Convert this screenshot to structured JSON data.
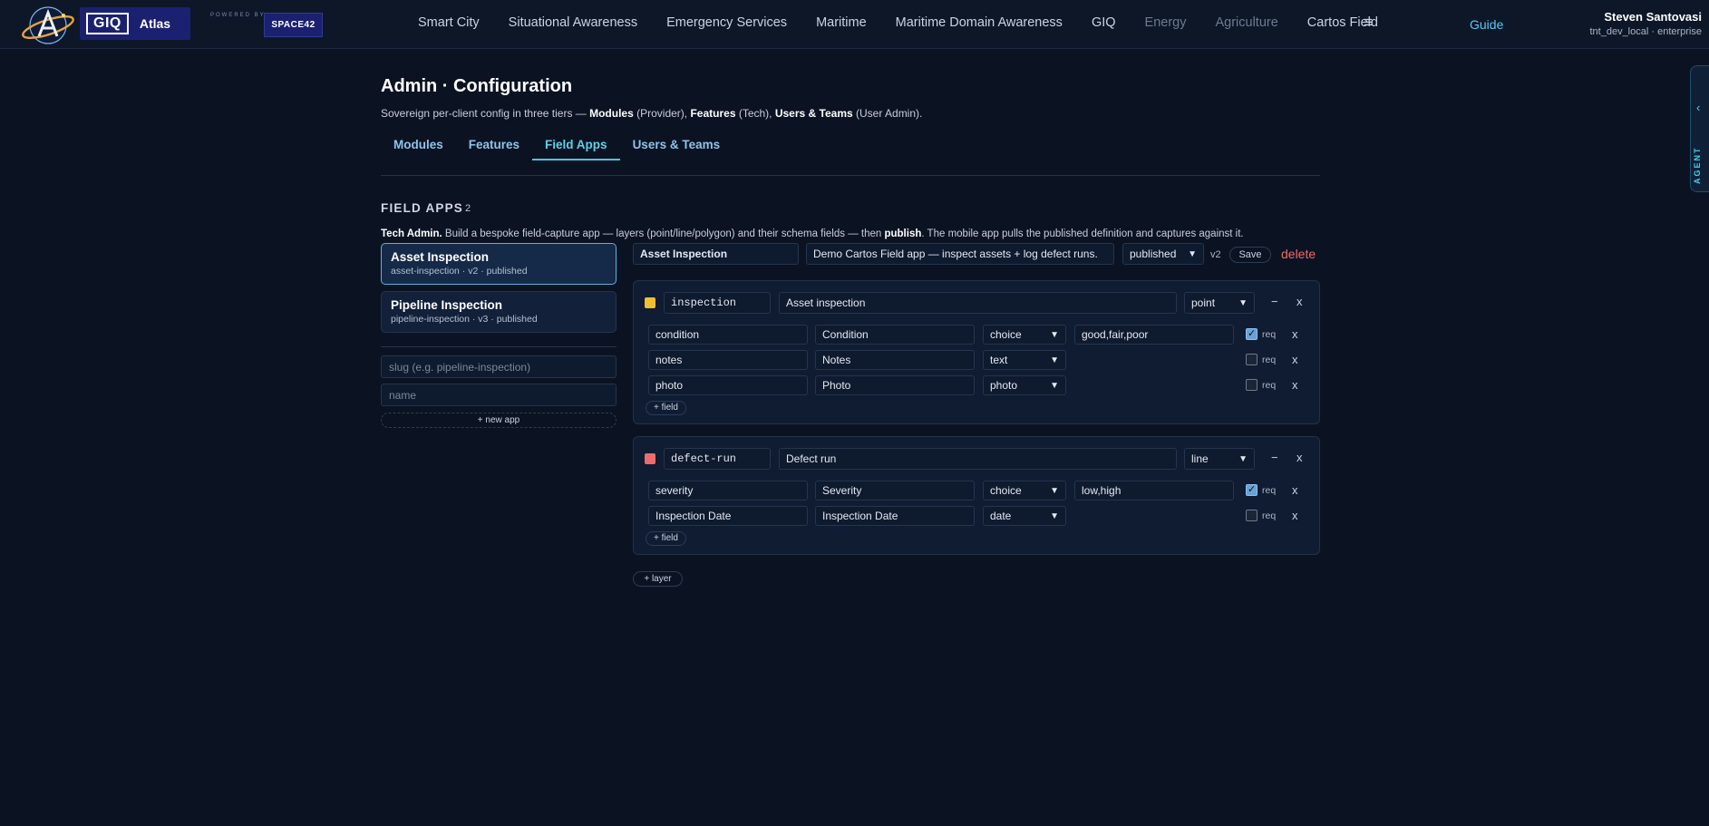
{
  "brand": {
    "short": "GIQ",
    "name": "Atlas",
    "powered_by": "POWERED BY",
    "partner": "SPACE42"
  },
  "nav": {
    "items": [
      {
        "label": "Smart City",
        "dim": false
      },
      {
        "label": "Situational Awareness",
        "dim": false
      },
      {
        "label": "Emergency Services",
        "dim": false
      },
      {
        "label": "Maritime",
        "dim": false
      },
      {
        "label": "Maritime Domain Awareness",
        "dim": false
      },
      {
        "label": "GIQ",
        "dim": false
      },
      {
        "label": "Energy",
        "dim": true
      },
      {
        "label": "Agriculture",
        "dim": true
      },
      {
        "label": "Cartos Field",
        "dim": false
      }
    ],
    "menu_icon": "hamburger-icon",
    "guide": "Guide"
  },
  "user": {
    "name": "Steven Santovasi",
    "sub": "tnt_dev_local · enterprise"
  },
  "agent": {
    "label": "AGENT",
    "icon": "chevron-left-icon"
  },
  "page": {
    "title": "Admin · Configuration",
    "subtitle": {
      "pre": "Sovereign per-client config in three tiers — ",
      "b1": "Modules",
      "t1": " (Provider), ",
      "b2": "Features",
      "t2": " (Tech), ",
      "b3": "Users & Teams",
      "t3": " (User Admin)."
    },
    "tabs": [
      "Modules",
      "Features",
      "Field Apps",
      "Users & Teams"
    ],
    "active_tab": "Field Apps"
  },
  "section": {
    "title": "FIELD APPS",
    "count": "2",
    "desc": {
      "b1": "Tech Admin.",
      "t1": " Build a bespoke field-capture app — layers (point/line/polygon) and their schema fields — then ",
      "b2": "publish",
      "t2": ". The mobile app pulls the published definition and captures against it."
    }
  },
  "apps": [
    {
      "name": "Asset Inspection",
      "meta": "asset-inspection · v2 · published",
      "selected": true
    },
    {
      "name": "Pipeline Inspection",
      "meta": "pipeline-inspection · v3 · published",
      "selected": false
    }
  ],
  "new_app": {
    "slug_placeholder": "slug (e.g. pipeline-inspection)",
    "name_placeholder": "name",
    "button": "+ new app"
  },
  "editor": {
    "name": "Asset Inspection",
    "description": "Demo Cartos Field app — inspect assets + log defect runs.",
    "status": "published",
    "version": "v2",
    "save": "Save",
    "delete": "delete",
    "add_field": "+ field",
    "add_layer": "+ layer",
    "req_label": "req",
    "collapse_icon": "−",
    "remove_icon": "x",
    "layers": [
      {
        "color": "#f0c030",
        "slug": "inspection",
        "title": "Asset inspection",
        "geometry": "point",
        "fields": [
          {
            "key": "condition",
            "label": "Condition",
            "type": "choice",
            "options": "good,fair,poor",
            "req": true
          },
          {
            "key": "notes",
            "label": "Notes",
            "type": "text",
            "options": "",
            "req": false
          },
          {
            "key": "photo",
            "label": "Photo",
            "type": "photo",
            "options": "",
            "req": false
          }
        ]
      },
      {
        "color": "#ee6b6b",
        "slug": "defect-run",
        "title": "Defect run",
        "geometry": "line",
        "fields": [
          {
            "key": "severity",
            "label": "Severity",
            "type": "choice",
            "options": "low,high",
            "req": true
          },
          {
            "key": "Inspection Date",
            "label": "Inspection Date",
            "type": "date",
            "options": "",
            "req": false
          }
        ]
      }
    ]
  }
}
